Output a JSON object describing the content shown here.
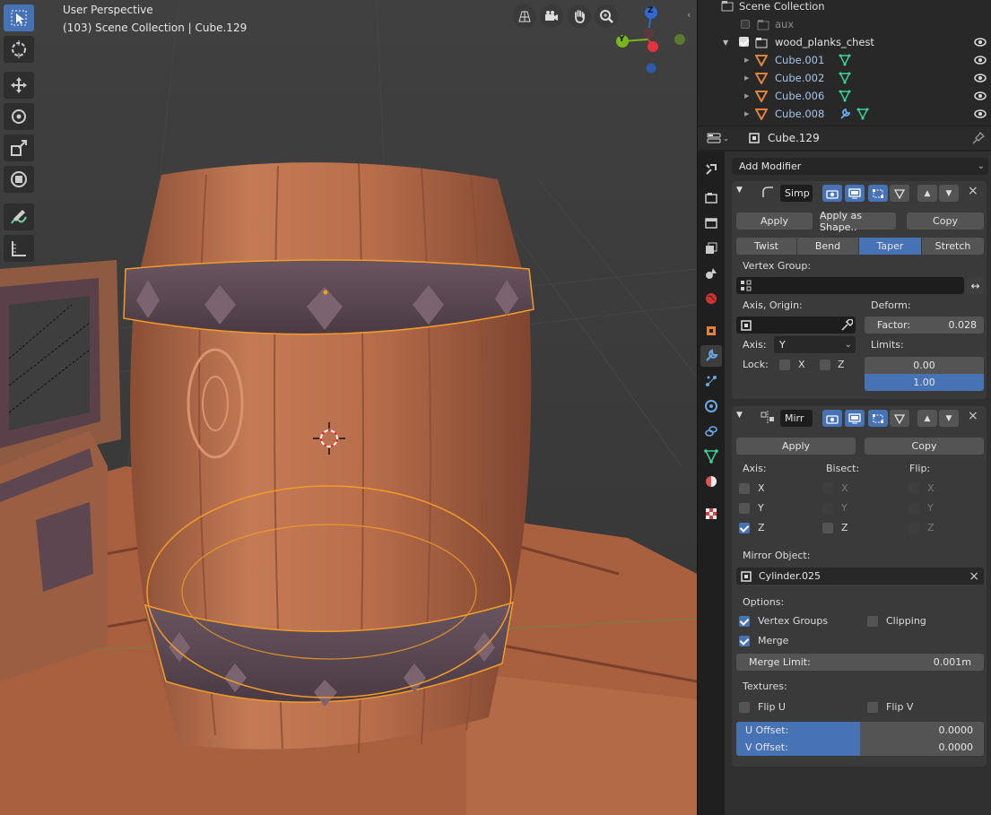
{
  "viewport": {
    "perspective_label": "User Perspective",
    "context_label": "(103) Scene Collection | Cube.129",
    "gizmo": {
      "z": "Z",
      "y": "Y"
    },
    "tools": [
      "select-box-icon",
      "cursor-icon",
      "move-icon",
      "rotate-icon",
      "scale-icon",
      "transform-icon",
      "annotate-icon",
      "measure-icon"
    ],
    "nav": [
      "grid-view-icon",
      "camera-icon",
      "hand-pan-icon",
      "zoom-icon"
    ]
  },
  "outliner": {
    "root": "Scene Collection",
    "rows": [
      {
        "name": "aux",
        "type": "collection",
        "checked": false,
        "dim": true
      },
      {
        "name": "wood_planks_chest",
        "type": "collection",
        "checked": true
      },
      {
        "name": "Cube.001",
        "type": "mesh"
      },
      {
        "name": "Cube.002",
        "type": "mesh"
      },
      {
        "name": "Cube.006",
        "type": "mesh"
      },
      {
        "name": "Cube.008",
        "type": "mesh",
        "modifier": true
      }
    ]
  },
  "properties": {
    "object_name": "Cube.129",
    "add_modifier": "Add Modifier",
    "simple_deform": {
      "name": "Simp",
      "apply": "Apply",
      "apply_shape": "Apply as Shape..",
      "copy": "Copy",
      "modes": [
        "Twist",
        "Bend",
        "Taper",
        "Stretch"
      ],
      "active_mode": "Taper",
      "vertex_group_label": "Vertex Group:",
      "axis_origin_label": "Axis, Origin:",
      "deform_label": "Deform:",
      "factor_label": "Factor:",
      "factor_value": "0.028",
      "axis_label": "Axis:",
      "axis_value": "Y",
      "limits_label": "Limits:",
      "limit_low": "0.00",
      "limit_high": "1.00",
      "lock_label": "Lock:",
      "lock_x": "X",
      "lock_z": "Z"
    },
    "mirror": {
      "name": "Mirr",
      "apply": "Apply",
      "copy": "Copy",
      "axis_label": "Axis:",
      "bisect_label": "Bisect:",
      "flip_label": "Flip:",
      "x": "X",
      "y": "Y",
      "z": "Z",
      "mirror_object_label": "Mirror Object:",
      "mirror_object": "Cylinder.025",
      "options_label": "Options:",
      "vertex_groups": "Vertex Groups",
      "clipping": "Clipping",
      "merge": "Merge",
      "merge_limit_label": "Merge Limit:",
      "merge_limit_value": "0.001m",
      "textures_label": "Textures:",
      "flip_u": "Flip U",
      "flip_v": "Flip V",
      "u_offset_label": "U Offset:",
      "u_offset_value": "0.0000",
      "v_offset_label": "V Offset:",
      "v_offset_value": "0.0000",
      "offset_fill": 0.5
    }
  },
  "colors": {
    "accent_blue": "#4772b3",
    "selection_orange": "#f29b2b",
    "mesh_icon_orange": "#e0823a",
    "vertex_green": "#3bd19a",
    "axis_blue": "#2f6ad0",
    "axis_green": "#7ab51d",
    "axis_red": "#e8313f"
  }
}
